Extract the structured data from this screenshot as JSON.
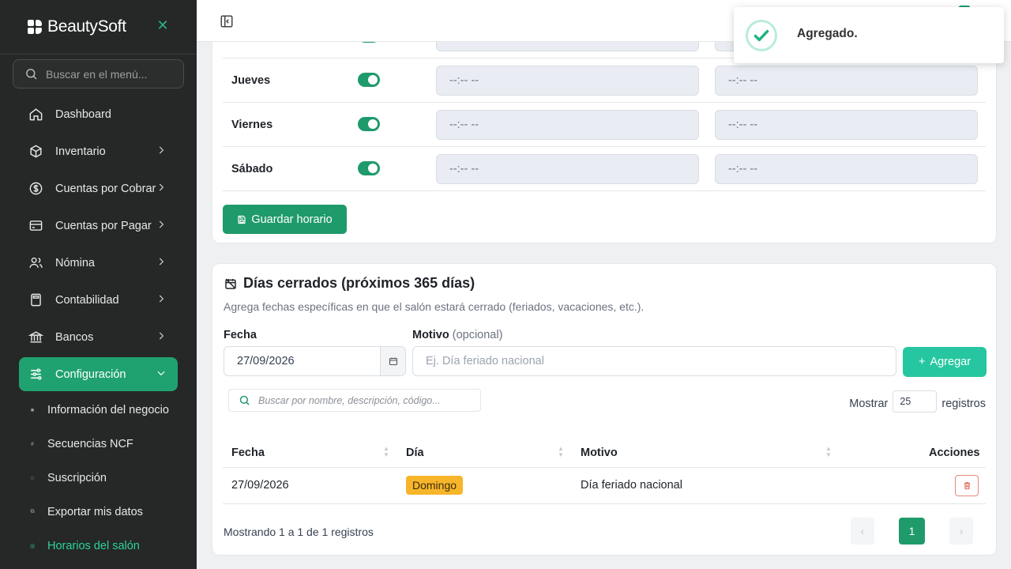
{
  "brand": {
    "name": "BeautySoft"
  },
  "sidebar": {
    "search_placeholder": "Buscar en el menú...",
    "items": [
      {
        "label": "Dashboard",
        "icon": "home-icon"
      },
      {
        "label": "Inventario",
        "icon": "box-icon"
      },
      {
        "label": "Cuentas por Cobrar",
        "icon": "dollar-circle-icon"
      },
      {
        "label": "Cuentas por Pagar",
        "icon": "credit-card-icon"
      },
      {
        "label": "Nómina",
        "icon": "users-icon"
      },
      {
        "label": "Contabilidad",
        "icon": "calculator-icon"
      },
      {
        "label": "Bancos",
        "icon": "bank-icon"
      },
      {
        "label": "Configuración",
        "icon": "sliders-icon"
      }
    ],
    "subitems": [
      {
        "label": "Información del negocio"
      },
      {
        "label": "Secuencias NCF"
      },
      {
        "label": "Suscripción"
      },
      {
        "label": "Exportar mis datos"
      },
      {
        "label": "Horarios del salón"
      }
    ]
  },
  "schedule": {
    "rows": [
      {
        "day": "",
        "open": "",
        "close": ""
      },
      {
        "day": "Jueves",
        "open": "--:-- --",
        "close": "--:-- --"
      },
      {
        "day": "Viernes",
        "open": "--:-- --",
        "close": "--:-- --"
      },
      {
        "day": "Sábado",
        "open": "--:-- --",
        "close": "--:-- --"
      }
    ],
    "save_label": "Guardar horario"
  },
  "closed_days": {
    "title": "Días cerrados (próximos 365 días)",
    "subtitle": "Agrega fechas específicas en que el salón estará cerrado (feriados, vacaciones, etc.).",
    "date_label": "Fecha",
    "date_value": "27/09/2026",
    "reason_label": "Motivo",
    "reason_optional": "(opcional)",
    "reason_placeholder": "Ej. Día feriado nacional",
    "add_label": "Agregar",
    "search_placeholder": "Buscar por nombre, descripción, código...",
    "show_label": "Mostrar",
    "show_value": "25",
    "records_label": "registros",
    "columns": [
      "Fecha",
      "Día",
      "Motivo",
      "Acciones"
    ],
    "rows": [
      {
        "fecha": "27/09/2026",
        "dia": "Domingo",
        "motivo": "Día feriado nacional"
      }
    ],
    "footer": "Mostrando 1 a 1 de 1 registros",
    "pagination": {
      "prev": "‹",
      "current": "1",
      "next": "›"
    }
  },
  "toast": {
    "message": "Agregado."
  },
  "colors": {
    "primary": "#1f9a6b",
    "accent": "#26c7a0",
    "sidebar": "#252827",
    "badge": "#f7b52c"
  }
}
